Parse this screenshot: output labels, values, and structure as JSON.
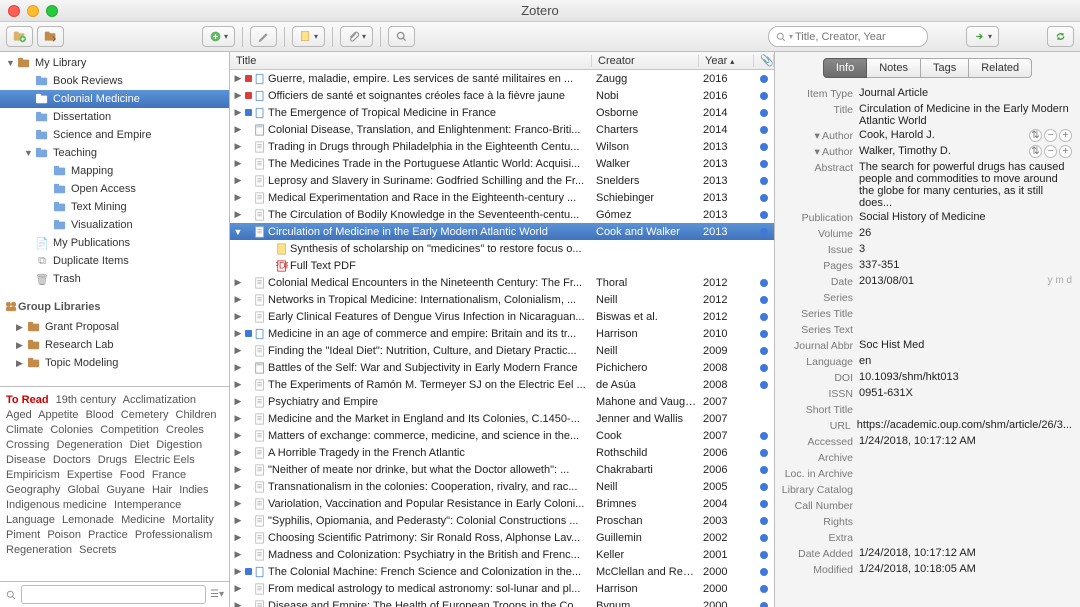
{
  "window": {
    "title": "Zotero"
  },
  "toolbar": {
    "search_placeholder": "Title, Creator, Year"
  },
  "left": {
    "library_label": "My Library",
    "collections": [
      {
        "label": "Book Reviews",
        "indent": 1
      },
      {
        "label": "Colonial Medicine",
        "indent": 1,
        "selected": true
      },
      {
        "label": "Dissertation",
        "indent": 1
      },
      {
        "label": "Science and Empire",
        "indent": 1
      },
      {
        "label": "Teaching",
        "indent": 1,
        "expanded": true
      },
      {
        "label": "Mapping",
        "indent": 2
      },
      {
        "label": "Open Access",
        "indent": 2
      },
      {
        "label": "Text Mining",
        "indent": 2
      },
      {
        "label": "Visualization",
        "indent": 2
      }
    ],
    "special": [
      {
        "label": "My Publications",
        "icon": "doc"
      },
      {
        "label": "Duplicate Items",
        "icon": "dup"
      },
      {
        "label": "Trash",
        "icon": "trash"
      }
    ],
    "group_header": "Group Libraries",
    "groups": [
      {
        "label": "Grant Proposal"
      },
      {
        "label": "Research Lab"
      },
      {
        "label": "Topic Modeling"
      }
    ],
    "tags": [
      "To Read",
      "19th century",
      "Acclimatization",
      "Aged",
      "Appetite",
      "Blood",
      "Cemetery",
      "Children",
      "Climate",
      "Colonies",
      "Competition",
      "Creoles",
      "Crossing",
      "Degeneration",
      "Diet",
      "Digestion",
      "Disease",
      "Doctors",
      "Drugs",
      "Electric Eels",
      "Empiricism",
      "Expertise",
      "Food",
      "France",
      "Geography",
      "Global",
      "Guyane",
      "Hair",
      "Indies",
      "Indigenous medicine",
      "Intemperance",
      "Language",
      "Lemonade",
      "Medicine",
      "Mortality",
      "Piment",
      "Poison",
      "Practice",
      "Professionalism",
      "Regeneration",
      "Secrets"
    ]
  },
  "center": {
    "headers": {
      "title": "Title",
      "creator": "Creator",
      "year": "Year"
    },
    "items": [
      {
        "marker": "red",
        "type": "book",
        "title": "Guerre, maladie, empire. Les services de santé militaires en ...",
        "creator": "Zaugg",
        "year": "2016",
        "att": true
      },
      {
        "marker": "red",
        "type": "book",
        "title": "Officiers de santé et soignantes créoles face à la fièvre jaune",
        "creator": "Nobi",
        "year": "2016",
        "att": true
      },
      {
        "marker": "blue",
        "type": "book",
        "title": "The Emergence of Tropical Medicine in France",
        "creator": "Osborne",
        "year": "2014",
        "att": true
      },
      {
        "type": "journal",
        "title": "Colonial Disease, Translation, and Enlightenment: Franco-Briti...",
        "creator": "Charters",
        "year": "2014",
        "att": true
      },
      {
        "type": "doc",
        "title": "Trading in Drugs through Philadelphia in the Eighteenth Centu...",
        "creator": "Wilson",
        "year": "2013",
        "att": true
      },
      {
        "type": "doc",
        "title": "The Medicines Trade in the Portuguese Atlantic World: Acquisi...",
        "creator": "Walker",
        "year": "2013",
        "att": true
      },
      {
        "type": "doc",
        "title": "Leprosy and Slavery in Suriname: Godfried Schilling and the Fr...",
        "creator": "Snelders",
        "year": "2013",
        "att": true
      },
      {
        "type": "doc",
        "title": "Medical Experimentation and Race in the Eighteenth-century ...",
        "creator": "Schiebinger",
        "year": "2013",
        "att": true
      },
      {
        "type": "doc",
        "title": "The Circulation of Bodily Knowledge in the Seventeenth-centu...",
        "creator": "Gómez",
        "year": "2013",
        "att": true
      },
      {
        "selected": true,
        "expanded": true,
        "type": "doc",
        "title": "Circulation of Medicine in the Early Modern Atlantic World",
        "creator": "Cook and Walker",
        "year": "2013",
        "att": true
      },
      {
        "child": true,
        "type": "note",
        "title": "Synthesis of scholarship on \"medicines\" to restore focus o..."
      },
      {
        "child": true,
        "type": "pdf",
        "title": "Full Text PDF"
      },
      {
        "type": "doc",
        "title": "Colonial Medical Encounters in the Nineteenth Century: The Fr...",
        "creator": "Thoral",
        "year": "2012",
        "att": true
      },
      {
        "type": "doc",
        "title": "Networks in Tropical Medicine: Internationalism, Colonialism, ...",
        "creator": "Neill",
        "year": "2012",
        "att": true
      },
      {
        "type": "doc",
        "title": "Early Clinical Features of Dengue Virus Infection in Nicaraguan...",
        "creator": "Biswas et al.",
        "year": "2012",
        "att": true
      },
      {
        "marker": "blue",
        "type": "book",
        "title": "Medicine in an age of commerce and empire: Britain and its tr...",
        "creator": "Harrison",
        "year": "2010",
        "att": true
      },
      {
        "type": "doc",
        "title": "Finding the \"Ideal Diet\": Nutrition, Culture, and Dietary Practic...",
        "creator": "Neill",
        "year": "2009",
        "att": true
      },
      {
        "type": "journal",
        "title": "Battles of the Self: War and Subjectivity in Early Modern France",
        "creator": "Pichichero",
        "year": "2008",
        "att": true
      },
      {
        "type": "doc",
        "title": "The Experiments of Ramón M. Termeyer SJ on the Electric Eel ...",
        "creator": "de Asúa",
        "year": "2008",
        "att": true
      },
      {
        "type": "doc",
        "title": "Psychiatry and Empire",
        "creator": "Mahone and Vaughan",
        "year": "2007"
      },
      {
        "type": "doc",
        "title": "Medicine and the Market in England and Its Colonies, C.1450-...",
        "creator": "Jenner and Wallis",
        "year": "2007"
      },
      {
        "type": "doc",
        "title": "Matters of exchange: commerce, medicine, and science in the...",
        "creator": "Cook",
        "year": "2007",
        "att": true
      },
      {
        "type": "doc",
        "title": "A Horrible Tragedy in the French Atlantic",
        "creator": "Rothschild",
        "year": "2006",
        "att": true
      },
      {
        "type": "doc",
        "title": "\"Neither of meate nor drinke, but what the Doctor alloweth\": ...",
        "creator": "Chakrabarti",
        "year": "2006",
        "att": true
      },
      {
        "type": "doc",
        "title": "Transnationalism in the colonies: Cooperation, rivalry, and rac...",
        "creator": "Neill",
        "year": "2005",
        "att": true
      },
      {
        "type": "doc",
        "title": "Variolation, Vaccination and Popular Resistance in Early Coloni...",
        "creator": "Brimnes",
        "year": "2004",
        "att": true
      },
      {
        "type": "doc",
        "title": "\"Syphilis, Opiomania, and Pederasty\": Colonial Constructions ...",
        "creator": "Proschan",
        "year": "2003",
        "att": true
      },
      {
        "type": "doc",
        "title": "Choosing Scientific Patrimony: Sir Ronald Ross, Alphonse Lav...",
        "creator": "Guillemin",
        "year": "2002",
        "att": true
      },
      {
        "type": "doc",
        "title": "Madness and Colonization: Psychiatry in the British and Frenc...",
        "creator": "Keller",
        "year": "2001",
        "att": true
      },
      {
        "marker": "blue",
        "type": "book",
        "title": "The Colonial Machine: French Science and Colonization in the...",
        "creator": "McClellan and Rego...",
        "year": "2000",
        "att": true
      },
      {
        "type": "doc",
        "title": "From medical astrology to medical astronomy: sol-lunar and pl...",
        "creator": "Harrison",
        "year": "2000",
        "att": true
      },
      {
        "type": "doc",
        "title": "Disease and Empire: The Health of European Troops in the Co...",
        "creator": "Bynum",
        "year": "2000",
        "att": true
      }
    ]
  },
  "right": {
    "tabs": [
      "Info",
      "Notes",
      "Tags",
      "Related"
    ],
    "fields": [
      {
        "label": "Item Type",
        "value": "Journal Article"
      },
      {
        "label": "Title",
        "value": "Circulation of Medicine in the Early Modern Atlantic World"
      },
      {
        "label": "▾ Author",
        "value": "Cook, Harold J.",
        "ctrl": true
      },
      {
        "label": "▾ Author",
        "value": "Walker, Timothy D.",
        "ctrl": true
      },
      {
        "label": "Abstract",
        "value": "The search for powerful drugs has caused people and commodities to move around the globe for many centuries, as it still does..."
      },
      {
        "label": "Publication",
        "value": "Social History of Medicine"
      },
      {
        "label": "Volume",
        "value": "26"
      },
      {
        "label": "Issue",
        "value": "3"
      },
      {
        "label": "Pages",
        "value": "337-351"
      },
      {
        "label": "Date",
        "value": "2013/08/01",
        "suffix": "y m d"
      },
      {
        "label": "Series",
        "value": ""
      },
      {
        "label": "Series Title",
        "value": ""
      },
      {
        "label": "Series Text",
        "value": ""
      },
      {
        "label": "Journal Abbr",
        "value": "Soc Hist Med"
      },
      {
        "label": "Language",
        "value": "en"
      },
      {
        "label": "DOI",
        "value": "10.1093/shm/hkt013"
      },
      {
        "label": "ISSN",
        "value": "0951-631X"
      },
      {
        "label": "Short Title",
        "value": ""
      },
      {
        "label": "URL",
        "value": "https://academic.oup.com/shm/article/26/3..."
      },
      {
        "label": "Accessed",
        "value": "1/24/2018, 10:17:12 AM"
      },
      {
        "label": "Archive",
        "value": ""
      },
      {
        "label": "Loc. in Archive",
        "value": ""
      },
      {
        "label": "Library Catalog",
        "value": ""
      },
      {
        "label": "Call Number",
        "value": ""
      },
      {
        "label": "Rights",
        "value": ""
      },
      {
        "label": "Extra",
        "value": ""
      },
      {
        "label": "Date Added",
        "value": "1/24/2018, 10:17:12 AM"
      },
      {
        "label": "Modified",
        "value": "1/24/2018, 10:18:05 AM"
      }
    ]
  }
}
